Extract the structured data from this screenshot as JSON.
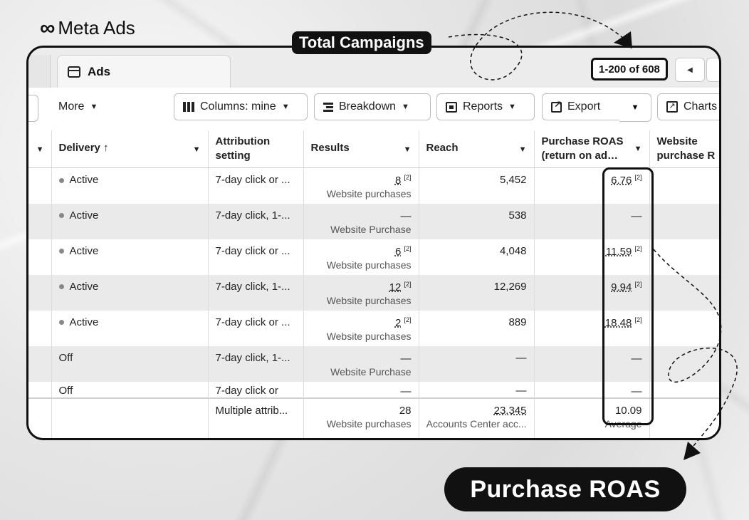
{
  "brand": {
    "name": "Meta",
    "product": "Ads"
  },
  "tab": {
    "label": "Ads"
  },
  "pagination": {
    "label": "1-200 of 608"
  },
  "toolbar": {
    "more": "More",
    "columns": "Columns: mine",
    "breakdown": "Breakdown",
    "reports": "Reports",
    "export": "Export",
    "charts": "Charts"
  },
  "table": {
    "headers": {
      "delivery": "Delivery ↑",
      "attribution": "Attribution setting",
      "results": "Results",
      "reach": "Reach",
      "roas": "Purchase ROAS (return on ad…",
      "website_roas": "Website purchase R"
    },
    "rows": [
      {
        "delivery": "Active",
        "attribution": "7-day click or ...",
        "results": "8",
        "results_note": "[2]",
        "results_type": "Website purchases",
        "reach": "5,452",
        "roas": "6.76",
        "roas_note": "[2]"
      },
      {
        "delivery": "Active",
        "attribution": "7-day click, 1-...",
        "results": "—",
        "results_note": "",
        "results_type": "Website Purchase",
        "reach": "538",
        "roas": "—",
        "roas_note": ""
      },
      {
        "delivery": "Active",
        "attribution": "7-day click or ...",
        "results": "6",
        "results_note": "[2]",
        "results_type": "Website purchases",
        "reach": "4,048",
        "roas": "11.59",
        "roas_note": "[2]"
      },
      {
        "delivery": "Active",
        "attribution": "7-day click, 1-...",
        "results": "12",
        "results_note": "[2]",
        "results_type": "Website purchases",
        "reach": "12,269",
        "roas": "9.94",
        "roas_note": "[2]"
      },
      {
        "delivery": "Active",
        "attribution": "7-day click or ...",
        "results": "2",
        "results_note": "[2]",
        "results_type": "Website purchases",
        "reach": "889",
        "roas": "18.48",
        "roas_note": "[2]"
      },
      {
        "delivery": "Off",
        "attribution": "7-day click, 1-...",
        "results": "—",
        "results_note": "",
        "results_type": "Website Purchase",
        "reach": "—",
        "roas": "—",
        "roas_note": ""
      },
      {
        "delivery": "Off",
        "attribution": "7-day click or",
        "results": "—",
        "results_note": "",
        "results_type": "",
        "reach": "—",
        "roas": "—",
        "roas_note": ""
      }
    ],
    "footer": {
      "attribution": "Multiple attrib...",
      "results": "28",
      "results_type": "Website purchases",
      "reach": "23,345",
      "reach_type": "Accounts Center acc...",
      "roas": "10.09",
      "roas_type": "Average"
    }
  },
  "callouts": {
    "top": "Total Campaigns",
    "bottom": "Purchase ROAS"
  }
}
